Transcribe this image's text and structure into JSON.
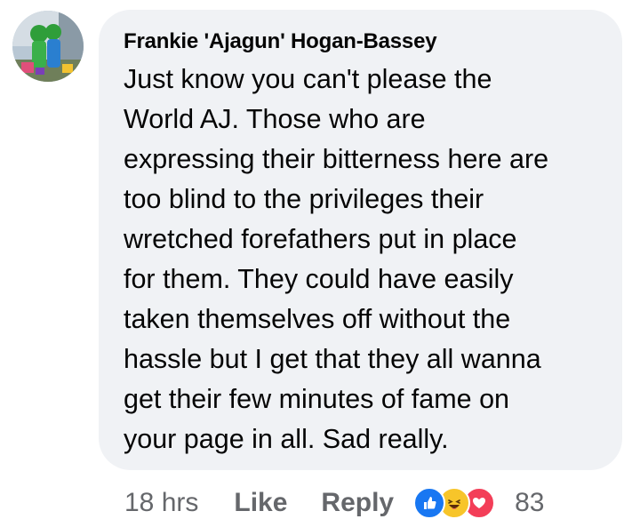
{
  "comment": {
    "author": "Frankie 'Ajagun' Hogan-Bassey",
    "text_lines": [
      "Just know you can't please the",
      "World AJ. Those who are",
      "expressing their bitterness here are",
      "too blind to the privileges their",
      "wretched forefathers put in place",
      "for them. They could have easily",
      "taken themselves off without the",
      "hassle but I get that they all wanna",
      "get their few minutes of fame on",
      "your page in all. Sad really."
    ],
    "time": "18 hrs",
    "like_label": "Like",
    "reply_label": "Reply",
    "reaction_count": "83",
    "reactions": [
      "like-icon",
      "haha-icon",
      "love-icon"
    ]
  },
  "colors": {
    "bubble": "#f0f2f5",
    "text": "#050505",
    "meta": "#65676b",
    "like_blue": "#1877f2",
    "haha_yellow": "#f7c52a",
    "love_red": "#f33e58"
  }
}
